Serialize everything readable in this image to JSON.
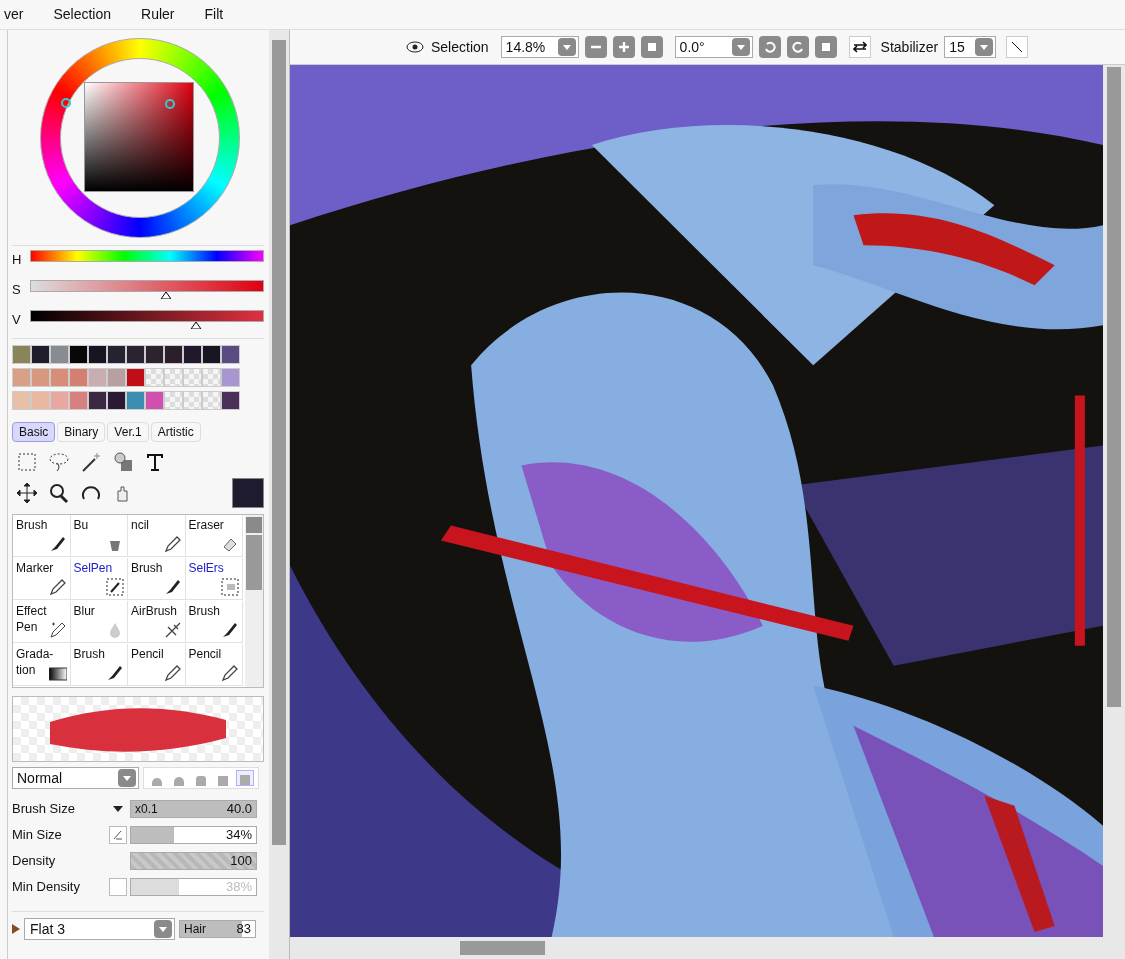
{
  "menu": [
    "ver",
    "Selection",
    "Ruler",
    "Filt"
  ],
  "hsv": [
    {
      "label": "H",
      "kind": "hue"
    },
    {
      "label": "S",
      "kind": "saturation",
      "level": 0.58
    },
    {
      "label": "V",
      "kind": "value",
      "level": 0.71
    }
  ],
  "swatch_rows": [
    [
      {
        "color": "#8a8558"
      },
      {
        "color": "#1f1e2a"
      },
      {
        "color": "#878c92"
      },
      {
        "color": "#080808"
      },
      {
        "color": "#171522"
      },
      {
        "color": "#262230"
      },
      {
        "color": "#2a2330"
      },
      {
        "color": "#2c2230"
      },
      {
        "color": "#2c1e2a"
      },
      {
        "color": "#21182c"
      },
      {
        "color": "#181622"
      },
      {
        "color": "#5a4c82"
      }
    ],
    [
      {
        "color": "#d9a088"
      },
      {
        "color": "#d89880"
      },
      {
        "color": "#d88d78"
      },
      {
        "color": "#d47f70"
      },
      {
        "color": "#c8aeb0"
      },
      {
        "color": "#b8a0a0"
      },
      {
        "color": "#c00e18"
      },
      {
        "kind": "empty"
      },
      {
        "kind": "empty"
      },
      {
        "kind": "empty"
      },
      {
        "kind": "empty"
      },
      {
        "color": "#a896d0"
      }
    ],
    [
      {
        "color": "#e8c0a8"
      },
      {
        "color": "#e8b8a0"
      },
      {
        "color": "#e8a8a0"
      },
      {
        "color": "#d88080"
      },
      {
        "color": "#3d2844"
      },
      {
        "color": "#2c1a34"
      },
      {
        "color": "#3a8cb0"
      },
      {
        "color": "#d050b0"
      },
      {
        "kind": "empty"
      },
      {
        "kind": "empty"
      },
      {
        "kind": "empty"
      },
      {
        "color": "#4a3058"
      }
    ]
  ],
  "tool_tabs": [
    {
      "label": "Basic",
      "selected": true
    },
    {
      "label": "Binary",
      "selected": false
    },
    {
      "label": "Ver.1",
      "selected": false
    },
    {
      "label": "Artistic",
      "selected": false
    }
  ],
  "tools": [
    {
      "label": "Brush",
      "kind": "brush"
    },
    {
      "label": "Bu",
      "kind": "bucket"
    },
    {
      "label": "ncil",
      "kind": "pencil"
    },
    {
      "label": "Eraser",
      "kind": "eraser"
    },
    {
      "label": "Marker",
      "kind": "pencil"
    },
    {
      "label": "SelPen",
      "kind": "selpen"
    },
    {
      "label": "Brush",
      "kind": "brush"
    },
    {
      "label": "SelErs",
      "kind": "selers"
    },
    {
      "label": "Effect Pen",
      "kind": "effect"
    },
    {
      "label": "Blur",
      "kind": "blur"
    },
    {
      "label": "AirBrush",
      "kind": "airbrush"
    },
    {
      "label": "Brush",
      "kind": "brush"
    },
    {
      "label": "Grada-tion",
      "kind": "gradation"
    },
    {
      "label": "Brush",
      "kind": "brush"
    },
    {
      "label": "Pencil",
      "kind": "pencil"
    },
    {
      "label": "Pencil",
      "kind": "pencil"
    }
  ],
  "blend_mode": "Normal",
  "brush_shapes": [
    {
      "selected": false
    },
    {
      "selected": false
    },
    {
      "selected": false
    },
    {
      "selected": false
    },
    {
      "selected": true
    }
  ],
  "settings": [
    {
      "label": "Brush Size",
      "kind": "size",
      "prefix": "x0.1",
      "value": "40.0",
      "level": 1
    },
    {
      "label": "Min Size",
      "kind": "min",
      "value": "34%",
      "level": 0.34
    },
    {
      "label": "Density",
      "kind": "density",
      "value": "100",
      "level": 1
    },
    {
      "label": "Min Density",
      "kind": "mindensity",
      "value": "38%",
      "level": 0.38,
      "checked": false
    }
  ],
  "texture": {
    "name": "Flat 3",
    "param": "Hair",
    "value": "83",
    "level": 0.83
  },
  "toolbar": {
    "selection_label": "Selection",
    "zoom": "14.8%",
    "angle": "0.0°",
    "stabilizer_label": "Stabilizer",
    "stabilizer": "15"
  }
}
